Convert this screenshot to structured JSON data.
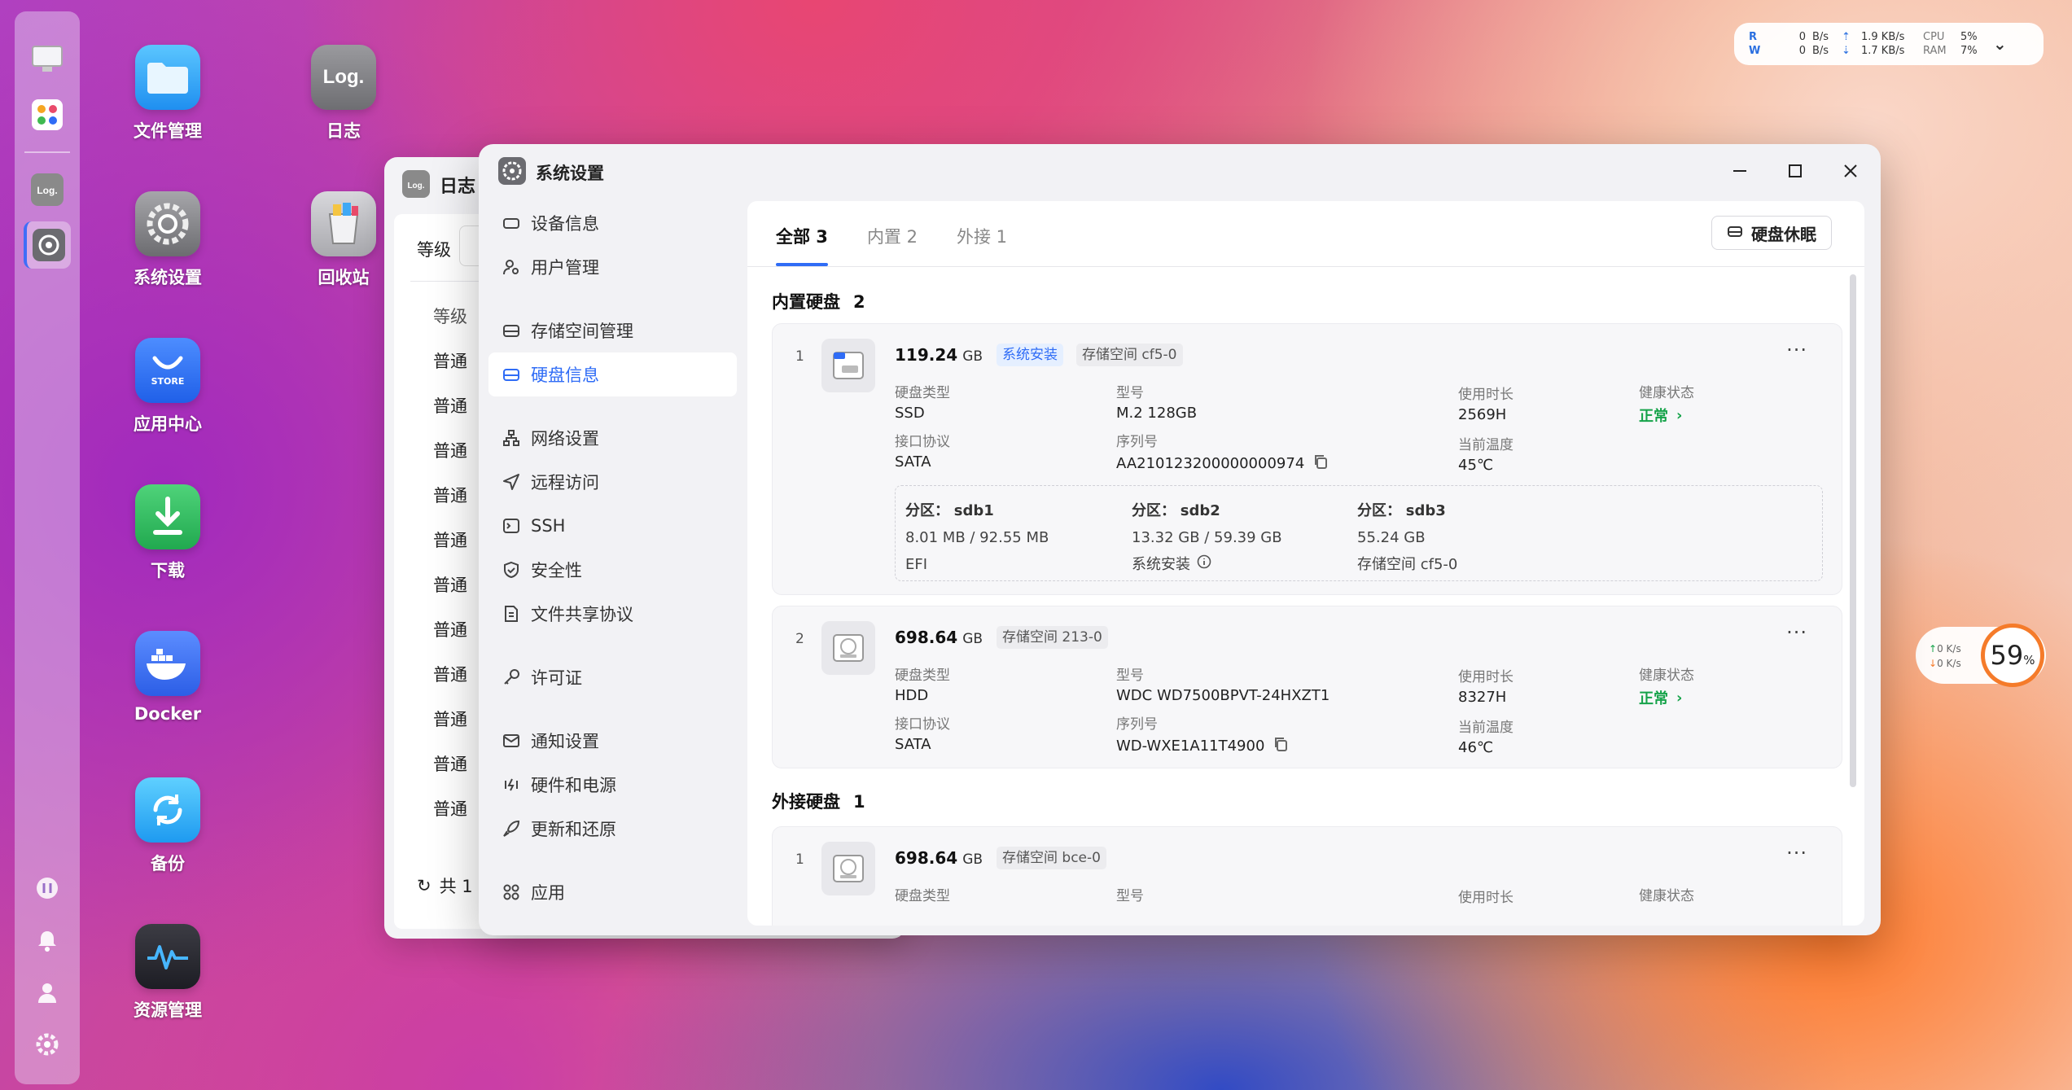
{
  "desktop": {
    "icons": [
      {
        "label": "文件管理"
      },
      {
        "label": "日志"
      },
      {
        "label": "系统设置"
      },
      {
        "label": "回收站"
      },
      {
        "label": "应用中心"
      },
      {
        "label": "下载"
      },
      {
        "label": "Docker"
      },
      {
        "label": "备份"
      },
      {
        "label": "资源管理"
      }
    ],
    "log_icon_text": "Log.",
    "store_text": "STORE"
  },
  "monitor": {
    "r_label": "R",
    "w_label": "W",
    "r_val": "0",
    "w_val": "0",
    "r_unit": "B/s",
    "w_unit": "B/s",
    "up_speed": "1.9 KB/s",
    "down_speed": "1.7 KB/s",
    "cpu_label": "CPU",
    "ram_label": "RAM",
    "cpu_val": "5%",
    "ram_val": "7%"
  },
  "netwidget": {
    "up": "0",
    "down": "0",
    "unit": "K/s",
    "percent": "59",
    "percent_sign": "%"
  },
  "logwindow": {
    "title": "日志",
    "level_label": "等级",
    "header": "等级",
    "rows": [
      "普通",
      "普通",
      "普通",
      "普通",
      "普通",
      "普通",
      "普通",
      "普通",
      "普通",
      "普通",
      "普通"
    ],
    "footer": "共 1"
  },
  "window": {
    "title": "系统设置",
    "sidebar": [
      {
        "label": "设备信息"
      },
      {
        "label": "用户管理"
      },
      {
        "label": "存储空间管理"
      },
      {
        "label": "硬盘信息"
      },
      {
        "label": "网络设置"
      },
      {
        "label": "远程访问"
      },
      {
        "label": "SSH"
      },
      {
        "label": "安全性"
      },
      {
        "label": "文件共享协议"
      },
      {
        "label": "许可证"
      },
      {
        "label": "通知设置"
      },
      {
        "label": "硬件和电源"
      },
      {
        "label": "更新和还原"
      },
      {
        "label": "应用"
      }
    ],
    "tabs": [
      "全部 3",
      "内置 2",
      "外接 1"
    ],
    "sleep_button": "硬盘休眠",
    "internal_title": "内置硬盘",
    "internal_count": "2",
    "external_title": "外接硬盘",
    "external_count": "1",
    "labels": {
      "type": "硬盘类型",
      "model": "型号",
      "uptime": "使用时长",
      "health": "健康状态",
      "interface": "接口协议",
      "serial": "序列号",
      "temp": "当前温度",
      "partition": "分区："
    },
    "disks": [
      {
        "index": "1",
        "capacity": "119.24",
        "unit": "GB",
        "tags": [
          "系统安装",
          "存储空间 cf5-0"
        ],
        "type": "SSD",
        "model": "M.2 128GB",
        "uptime": "2569H",
        "health": "正常",
        "interface": "SATA",
        "serial": "AA210123200000000974",
        "temp": "45℃",
        "partitions": [
          {
            "name": "sdb1",
            "size": "8.01 MB / 92.55 MB",
            "use": "EFI"
          },
          {
            "name": "sdb2",
            "size": "13.32 GB / 59.39 GB",
            "use": "系统安装"
          },
          {
            "name": "sdb3",
            "size": "55.24 GB",
            "use": "存储空间 cf5-0"
          }
        ]
      },
      {
        "index": "2",
        "capacity": "698.64",
        "unit": "GB",
        "tags": [
          "存储空间 213-0"
        ],
        "type": "HDD",
        "model": "WDC WD7500BPVT-24HXZT1",
        "uptime": "8327H",
        "health": "正常",
        "interface": "SATA",
        "serial": "WD-WXE1A11T4900",
        "temp": "46℃"
      },
      {
        "index": "1",
        "capacity": "698.64",
        "unit": "GB",
        "tags": [
          "存储空间 bce-0"
        ]
      }
    ]
  },
  "colors": {
    "accent": "#2f6cf6",
    "ok": "#16a34a",
    "ring": "#f57b2a"
  }
}
